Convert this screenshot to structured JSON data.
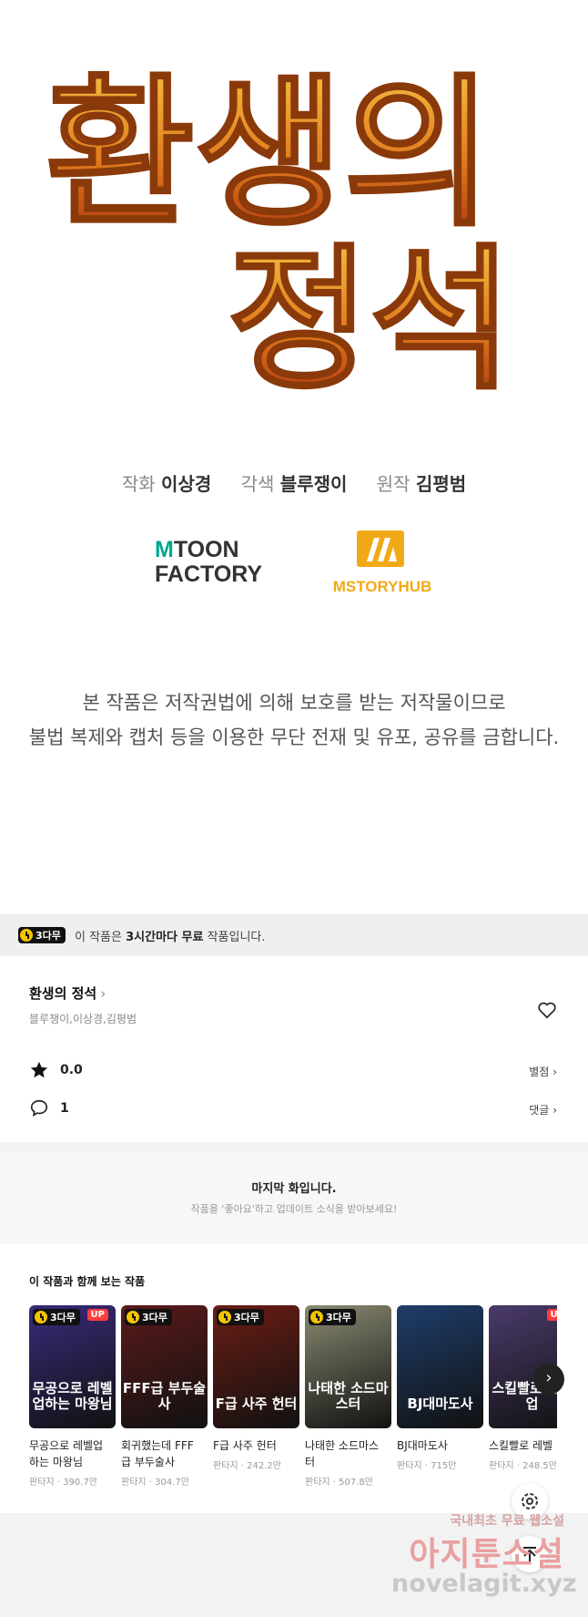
{
  "title_art": {
    "text": "환생의 정석"
  },
  "credits": [
    {
      "role": "작화",
      "name": "이상경"
    },
    {
      "role": "각색",
      "name": "블루쟁이"
    },
    {
      "role": "원작",
      "name": "김평범"
    }
  ],
  "logos": {
    "mtoon_line1": "TOON",
    "mtoon_line2": "FACTORY",
    "mstory": "MSTORYHUB"
  },
  "copyright": {
    "line1": "본 작품은 저작권법에 의해 보호를 받는 저작물이므로",
    "line2": "불법 복제와 캡처 등을 이용한 무단 전재 및 유포, 공유를 금합니다."
  },
  "free_banner": {
    "badge": "3다무",
    "prefix": "이 작품은 ",
    "bold": "3시간마다 무료",
    "suffix": " 작품입니다."
  },
  "work": {
    "title": "환생의 정석",
    "authors": "블루쟁이,이상경,김평범",
    "rating": "0.0",
    "rating_link": "별점",
    "comments": "1",
    "comments_link": "댓글"
  },
  "last_episode": {
    "title": "마지막 화입니다.",
    "subtitle": "작품을 '좋아요'하고 업데이트 소식을 받아보세요!"
  },
  "recommendations": {
    "header": "이 작품과 함께 보는 작품",
    "items": [
      {
        "cover_text": "무공으로 레벨업하는 마왕님",
        "badge": "3다무",
        "up": "UP",
        "name": "무공으로 레벨업\n하는 마왕님",
        "meta": "판타지 · 390.7만",
        "color": "#3a2a7a"
      },
      {
        "cover_text": "FFF급 부두술사",
        "badge": "3다무",
        "up": "",
        "name": "회귀했는데 FFF\n급 부두술사",
        "meta": "판타지 · 304.7만",
        "color": "#5a1a1a"
      },
      {
        "cover_text": "F급 사주 헌터",
        "badge": "3다무",
        "up": "",
        "name": "F급 사주 헌터",
        "meta": "판타지 · 242.2만",
        "color": "#6a1d14"
      },
      {
        "cover_text": "나태한 소드마스터",
        "badge": "3다무",
        "up": "",
        "name": "나태한 소드마스\n터",
        "meta": "판타지 · 507.8만",
        "color": "#8a8a72"
      },
      {
        "cover_text": "BJ대마도사",
        "badge": "",
        "up": "",
        "name": "BJ대마도사",
        "meta": "판타지 · 715만",
        "color": "#1f3d6a"
      },
      {
        "cover_text": "스킬빨로 레벨업",
        "badge": "",
        "up": "UP",
        "name": "스킬빨로 레벨",
        "meta": "판타지 · 248.5만",
        "color": "#4a3a6a"
      }
    ]
  },
  "watermark": {
    "line1": "국내최초 무료 웹소설",
    "line2": "아지툰소설",
    "line3": "novelagit.xyz"
  }
}
